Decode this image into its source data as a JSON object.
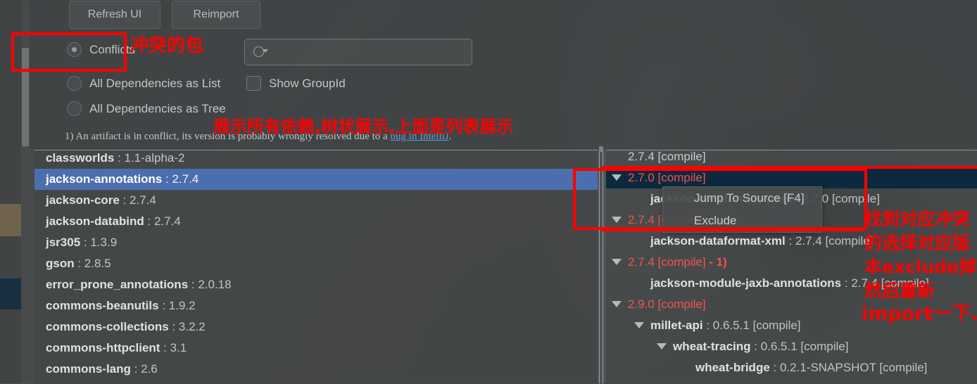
{
  "toolbar": {
    "refresh_label": "Refresh UI",
    "reimport_label": "Reimport"
  },
  "options": {
    "conflicts_label": "Conflicts",
    "all_as_list_label": "All Dependencies as List",
    "all_as_tree_label": "All Dependencies as Tree",
    "show_groupid_label": "Show GroupId",
    "selected": "Conflicts"
  },
  "search": {
    "value": "",
    "placeholder": "",
    "icon": "search-icon"
  },
  "note": {
    "prefix": "1) An artifact is in conflict, its version is probably wrongly resolved due to a ",
    "link": "bug in IntelliJ",
    "suffix": "."
  },
  "left_list": {
    "selected_index": 1,
    "items": [
      {
        "name": "classworlds",
        "version": "1.1-alpha-2"
      },
      {
        "name": "jackson-annotations",
        "version": "2.7.4"
      },
      {
        "name": "jackson-core",
        "version": "2.7.4"
      },
      {
        "name": "jackson-databind",
        "version": "2.7.4"
      },
      {
        "name": "jsr305",
        "version": "1.3.9"
      },
      {
        "name": "gson",
        "version": "2.8.5"
      },
      {
        "name": "error_prone_annotations",
        "version": "2.0.18"
      },
      {
        "name": "commons-beanutils",
        "version": "1.9.2"
      },
      {
        "name": "commons-collections",
        "version": "3.2.2"
      },
      {
        "name": "commons-httpclient",
        "version": "3.1"
      },
      {
        "name": "commons-lang",
        "version": "2.6"
      }
    ]
  },
  "right_tree": {
    "rows": [
      {
        "indent": 0,
        "arrow": false,
        "kind": "version-gray",
        "text": "2.7.4 [compile]",
        "selected": false
      },
      {
        "indent": 0,
        "arrow": true,
        "kind": "version-red",
        "text": "2.7.0 [compile]",
        "selected": true
      },
      {
        "indent": 1,
        "arrow": false,
        "kind": "artifact",
        "name": "jackson-dataformat-yaml",
        "version": "2.7.0 [compile]",
        "selected": false
      },
      {
        "indent": 0,
        "arrow": true,
        "kind": "version-red",
        "text": "2.7.4 [compile] - 1)",
        "selected": false
      },
      {
        "indent": 1,
        "arrow": false,
        "kind": "artifact",
        "name": "jackson-dataformat-xml",
        "version": "2.7.4 [compile]",
        "selected": false
      },
      {
        "indent": 0,
        "arrow": true,
        "kind": "version-red-note",
        "text": "2.7.4 [compile]",
        "suffix": " - 1)",
        "selected": false
      },
      {
        "indent": 1,
        "arrow": false,
        "kind": "artifact",
        "name": "jackson-module-jaxb-annotations",
        "version": "2.7.4 [compile]",
        "selected": false
      },
      {
        "indent": 0,
        "arrow": true,
        "kind": "version-red",
        "text": "2.9.0 [compile]",
        "selected": false
      },
      {
        "indent": 1,
        "arrow": true,
        "kind": "artifact",
        "name": "millet-api",
        "version": "0.6.5.1 [compile]",
        "selected": false
      },
      {
        "indent": 2,
        "arrow": true,
        "kind": "artifact",
        "name": "wheat-tracing",
        "version": "0.6.5.1 [compile]",
        "selected": false
      },
      {
        "indent": 3,
        "arrow": false,
        "kind": "artifact",
        "name": "wheat-bridge",
        "version": "0.2.1-SNAPSHOT [compile]",
        "selected": false
      }
    ]
  },
  "context_menu": {
    "items": [
      {
        "label": "Jump To Source [F4]"
      },
      {
        "label": "Exclude"
      }
    ]
  },
  "annotations": {
    "color": "#ff0000",
    "conflicts_note": "冲突的包",
    "tree_note": "展示所有依赖,树状展示,上面是列表展示",
    "right_line1": "找到对应冲突",
    "right_line2": "的选择对应版",
    "right_line3": "本exclude掉,",
    "right_line4": "然后重新",
    "right_line5": "import一下..."
  },
  "colors": {
    "list_selection": "#4b6eaf",
    "tree_selection": "#0d293e",
    "conflict_red": "#ef5350",
    "link_blue": "#5b9bd5",
    "annotation_red": "#ff0000"
  }
}
